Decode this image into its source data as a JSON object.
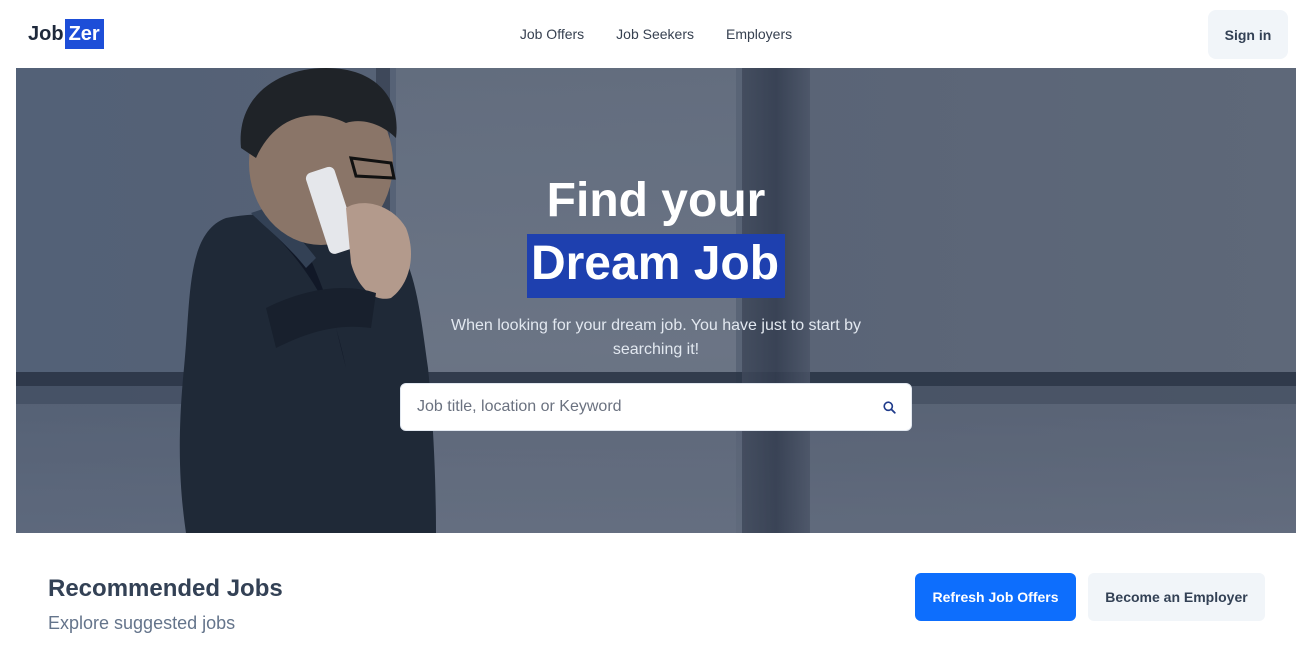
{
  "header": {
    "logo_part1": "Job",
    "logo_part2": "Zer",
    "nav": [
      "Job Offers",
      "Job Seekers",
      "Employers"
    ],
    "signin_label": "Sign in"
  },
  "hero": {
    "title_line1": "Find your",
    "title_line2": "Dream Job",
    "subtitle": "When looking for your dream job. You have just to start by searching it!",
    "search_placeholder": "Job title, location or Keyword",
    "search_value": "",
    "search_icon": "search-icon"
  },
  "recommended": {
    "title": "Recommended Jobs",
    "subtitle": "Explore suggested jobs",
    "refresh_label": "Refresh Job Offers",
    "employer_label": "Become an Employer"
  },
  "colors": {
    "brand": "#1d4ed8",
    "primary_button": "#0d6efd",
    "highlight": "#1e40af",
    "light_button": "#f1f5f9"
  }
}
